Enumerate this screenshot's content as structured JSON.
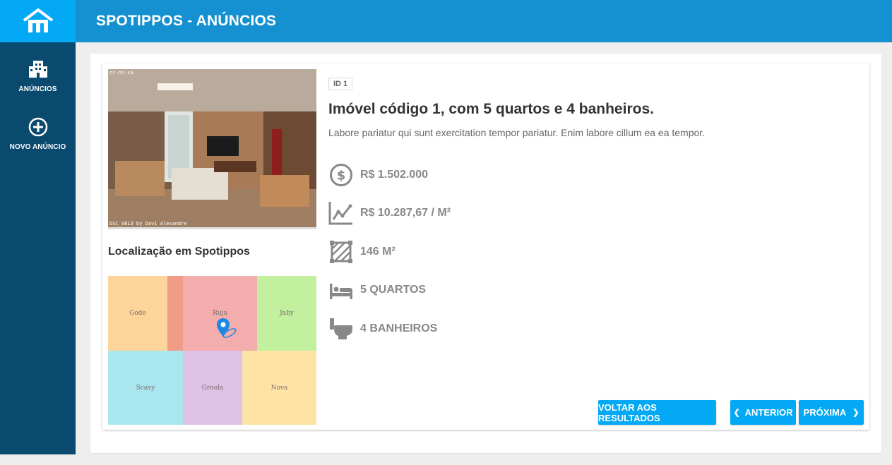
{
  "app": {
    "title": "SPOTIPPOS - ANÚNCIOS"
  },
  "sidebar": {
    "items": [
      {
        "label": "ANÚNCIOS",
        "icon": "building-icon"
      },
      {
        "label": "NOVO ANÚNCIO",
        "icon": "plus-circle-icon"
      }
    ]
  },
  "listing": {
    "photo": {
      "caption_top": "cc-nc-sa",
      "caption_bottom": "DSC_9813 by Davi Alexandre"
    },
    "id_badge": "ID 1",
    "title": "Imóvel código 1, com 5 quartos e 4 banheiros.",
    "description": "Labore pariatur qui sunt exercitation tempor pariatur. Enim labore cillum ea ea tempor.",
    "attributes": [
      {
        "icon": "dollar-circle-icon",
        "value": "R$ 1.502.000"
      },
      {
        "icon": "line-chart-icon",
        "value": "R$ 10.287,67 / M²"
      },
      {
        "icon": "area-square-icon",
        "value": "146 M²"
      },
      {
        "icon": "bed-icon",
        "value": "5 QUARTOS"
      },
      {
        "icon": "toilet-icon",
        "value": "4 BANHEIROS"
      }
    ],
    "location_title": "Localização em Spotippos",
    "map": {
      "regions": [
        "Gode",
        "Ruja",
        "Jaby",
        "Scavy",
        "Groola",
        "Nova"
      ],
      "colors": {
        "Gode": "#fdd59b",
        "Ruja": "#f4adad",
        "Jaby": "#c3f09e",
        "Scavy": "#a9e6f0",
        "Groola": "#dfc1e6",
        "Nova": "#fde4a6",
        "overlap": "#f19c86"
      },
      "marker_color": "#1e88e5"
    }
  },
  "buttons": {
    "back": "VOLTAR AOS RESULTADOS",
    "prev": "ANTERIOR",
    "next": "PRÓXIMA"
  }
}
